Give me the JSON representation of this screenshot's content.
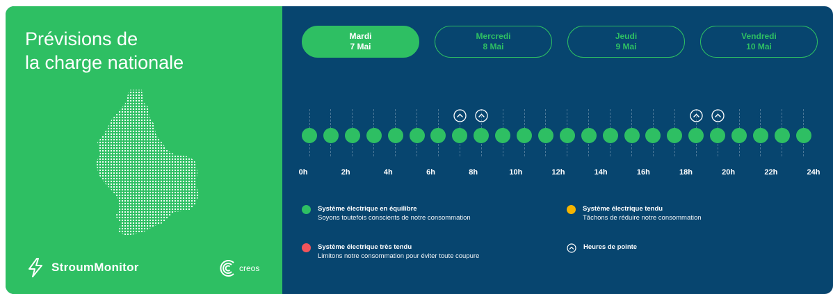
{
  "title": {
    "line1": "Prévisions de",
    "line2": "la charge nationale"
  },
  "brand": {
    "name": "StroumMonitor",
    "bolt_icon": "lightning-bolt-icon"
  },
  "partner": {
    "name": "creos",
    "logo_icon": "creos-logo-icon"
  },
  "colors": {
    "green": "#2ebf63",
    "navy": "#07456f",
    "orange": "#f5b400",
    "red": "#f2545b",
    "white": "#ffffff"
  },
  "tabs": [
    {
      "day": "Mardi",
      "date": "7 Mai",
      "active": true
    },
    {
      "day": "Mercredi",
      "date": "8 Mai",
      "active": false
    },
    {
      "day": "Jeudi",
      "date": "9 Mai",
      "active": false
    },
    {
      "day": "Vendredi",
      "date": "10 Mai",
      "active": false
    }
  ],
  "timeline": {
    "ticks": [
      "0h",
      "2h",
      "4h",
      "6h",
      "8h",
      "10h",
      "12h",
      "14h",
      "16h",
      "18h",
      "20h",
      "22h",
      "24h"
    ],
    "hours": [
      {
        "status": "equilibre",
        "peak": false
      },
      {
        "status": "equilibre",
        "peak": false
      },
      {
        "status": "equilibre",
        "peak": false
      },
      {
        "status": "equilibre",
        "peak": false
      },
      {
        "status": "equilibre",
        "peak": false
      },
      {
        "status": "equilibre",
        "peak": false
      },
      {
        "status": "equilibre",
        "peak": false
      },
      {
        "status": "equilibre",
        "peak": true
      },
      {
        "status": "equilibre",
        "peak": true
      },
      {
        "status": "equilibre",
        "peak": false
      },
      {
        "status": "equilibre",
        "peak": false
      },
      {
        "status": "equilibre",
        "peak": false
      },
      {
        "status": "equilibre",
        "peak": false
      },
      {
        "status": "equilibre",
        "peak": false
      },
      {
        "status": "equilibre",
        "peak": false
      },
      {
        "status": "equilibre",
        "peak": false
      },
      {
        "status": "equilibre",
        "peak": false
      },
      {
        "status": "equilibre",
        "peak": false
      },
      {
        "status": "equilibre",
        "peak": true
      },
      {
        "status": "equilibre",
        "peak": true
      },
      {
        "status": "equilibre",
        "peak": false
      },
      {
        "status": "equilibre",
        "peak": false
      },
      {
        "status": "equilibre",
        "peak": false
      },
      {
        "status": "equilibre",
        "peak": false
      }
    ],
    "peak_icon": "chevron-up-circle-icon"
  },
  "legend": {
    "equilibre": {
      "title": "Système électrique en équilibre",
      "desc": "Soyons toutefois conscients de notre consommation"
    },
    "tendu": {
      "title": "Système électrique tendu",
      "desc": "Tâchons de réduire notre consommation"
    },
    "tres_tendu": {
      "title": "Système électrique très tendu",
      "desc": "Limitons notre consommation pour éviter toute coupure"
    },
    "peak": {
      "title": "Heures de pointe"
    }
  }
}
